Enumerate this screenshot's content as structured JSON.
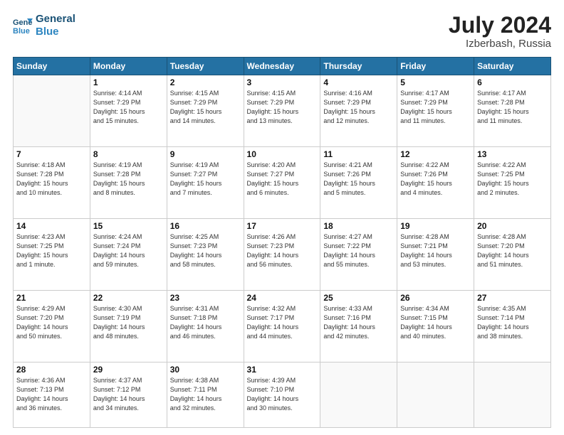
{
  "header": {
    "logo_line1": "General",
    "logo_line2": "Blue",
    "month_year": "July 2024",
    "location": "Izberbash, Russia"
  },
  "weekdays": [
    "Sunday",
    "Monday",
    "Tuesday",
    "Wednesday",
    "Thursday",
    "Friday",
    "Saturday"
  ],
  "weeks": [
    [
      {
        "day": "",
        "lines": []
      },
      {
        "day": "1",
        "lines": [
          "Sunrise: 4:14 AM",
          "Sunset: 7:29 PM",
          "Daylight: 15 hours",
          "and 15 minutes."
        ]
      },
      {
        "day": "2",
        "lines": [
          "Sunrise: 4:15 AM",
          "Sunset: 7:29 PM",
          "Daylight: 15 hours",
          "and 14 minutes."
        ]
      },
      {
        "day": "3",
        "lines": [
          "Sunrise: 4:15 AM",
          "Sunset: 7:29 PM",
          "Daylight: 15 hours",
          "and 13 minutes."
        ]
      },
      {
        "day": "4",
        "lines": [
          "Sunrise: 4:16 AM",
          "Sunset: 7:29 PM",
          "Daylight: 15 hours",
          "and 12 minutes."
        ]
      },
      {
        "day": "5",
        "lines": [
          "Sunrise: 4:17 AM",
          "Sunset: 7:29 PM",
          "Daylight: 15 hours",
          "and 11 minutes."
        ]
      },
      {
        "day": "6",
        "lines": [
          "Sunrise: 4:17 AM",
          "Sunset: 7:28 PM",
          "Daylight: 15 hours",
          "and 11 minutes."
        ]
      }
    ],
    [
      {
        "day": "7",
        "lines": [
          "Sunrise: 4:18 AM",
          "Sunset: 7:28 PM",
          "Daylight: 15 hours",
          "and 10 minutes."
        ]
      },
      {
        "day": "8",
        "lines": [
          "Sunrise: 4:19 AM",
          "Sunset: 7:28 PM",
          "Daylight: 15 hours",
          "and 8 minutes."
        ]
      },
      {
        "day": "9",
        "lines": [
          "Sunrise: 4:19 AM",
          "Sunset: 7:27 PM",
          "Daylight: 15 hours",
          "and 7 minutes."
        ]
      },
      {
        "day": "10",
        "lines": [
          "Sunrise: 4:20 AM",
          "Sunset: 7:27 PM",
          "Daylight: 15 hours",
          "and 6 minutes."
        ]
      },
      {
        "day": "11",
        "lines": [
          "Sunrise: 4:21 AM",
          "Sunset: 7:26 PM",
          "Daylight: 15 hours",
          "and 5 minutes."
        ]
      },
      {
        "day": "12",
        "lines": [
          "Sunrise: 4:22 AM",
          "Sunset: 7:26 PM",
          "Daylight: 15 hours",
          "and 4 minutes."
        ]
      },
      {
        "day": "13",
        "lines": [
          "Sunrise: 4:22 AM",
          "Sunset: 7:25 PM",
          "Daylight: 15 hours",
          "and 2 minutes."
        ]
      }
    ],
    [
      {
        "day": "14",
        "lines": [
          "Sunrise: 4:23 AM",
          "Sunset: 7:25 PM",
          "Daylight: 15 hours",
          "and 1 minute."
        ]
      },
      {
        "day": "15",
        "lines": [
          "Sunrise: 4:24 AM",
          "Sunset: 7:24 PM",
          "Daylight: 14 hours",
          "and 59 minutes."
        ]
      },
      {
        "day": "16",
        "lines": [
          "Sunrise: 4:25 AM",
          "Sunset: 7:23 PM",
          "Daylight: 14 hours",
          "and 58 minutes."
        ]
      },
      {
        "day": "17",
        "lines": [
          "Sunrise: 4:26 AM",
          "Sunset: 7:23 PM",
          "Daylight: 14 hours",
          "and 56 minutes."
        ]
      },
      {
        "day": "18",
        "lines": [
          "Sunrise: 4:27 AM",
          "Sunset: 7:22 PM",
          "Daylight: 14 hours",
          "and 55 minutes."
        ]
      },
      {
        "day": "19",
        "lines": [
          "Sunrise: 4:28 AM",
          "Sunset: 7:21 PM",
          "Daylight: 14 hours",
          "and 53 minutes."
        ]
      },
      {
        "day": "20",
        "lines": [
          "Sunrise: 4:28 AM",
          "Sunset: 7:20 PM",
          "Daylight: 14 hours",
          "and 51 minutes."
        ]
      }
    ],
    [
      {
        "day": "21",
        "lines": [
          "Sunrise: 4:29 AM",
          "Sunset: 7:20 PM",
          "Daylight: 14 hours",
          "and 50 minutes."
        ]
      },
      {
        "day": "22",
        "lines": [
          "Sunrise: 4:30 AM",
          "Sunset: 7:19 PM",
          "Daylight: 14 hours",
          "and 48 minutes."
        ]
      },
      {
        "day": "23",
        "lines": [
          "Sunrise: 4:31 AM",
          "Sunset: 7:18 PM",
          "Daylight: 14 hours",
          "and 46 minutes."
        ]
      },
      {
        "day": "24",
        "lines": [
          "Sunrise: 4:32 AM",
          "Sunset: 7:17 PM",
          "Daylight: 14 hours",
          "and 44 minutes."
        ]
      },
      {
        "day": "25",
        "lines": [
          "Sunrise: 4:33 AM",
          "Sunset: 7:16 PM",
          "Daylight: 14 hours",
          "and 42 minutes."
        ]
      },
      {
        "day": "26",
        "lines": [
          "Sunrise: 4:34 AM",
          "Sunset: 7:15 PM",
          "Daylight: 14 hours",
          "and 40 minutes."
        ]
      },
      {
        "day": "27",
        "lines": [
          "Sunrise: 4:35 AM",
          "Sunset: 7:14 PM",
          "Daylight: 14 hours",
          "and 38 minutes."
        ]
      }
    ],
    [
      {
        "day": "28",
        "lines": [
          "Sunrise: 4:36 AM",
          "Sunset: 7:13 PM",
          "Daylight: 14 hours",
          "and 36 minutes."
        ]
      },
      {
        "day": "29",
        "lines": [
          "Sunrise: 4:37 AM",
          "Sunset: 7:12 PM",
          "Daylight: 14 hours",
          "and 34 minutes."
        ]
      },
      {
        "day": "30",
        "lines": [
          "Sunrise: 4:38 AM",
          "Sunset: 7:11 PM",
          "Daylight: 14 hours",
          "and 32 minutes."
        ]
      },
      {
        "day": "31",
        "lines": [
          "Sunrise: 4:39 AM",
          "Sunset: 7:10 PM",
          "Daylight: 14 hours",
          "and 30 minutes."
        ]
      },
      {
        "day": "",
        "lines": []
      },
      {
        "day": "",
        "lines": []
      },
      {
        "day": "",
        "lines": []
      }
    ]
  ]
}
